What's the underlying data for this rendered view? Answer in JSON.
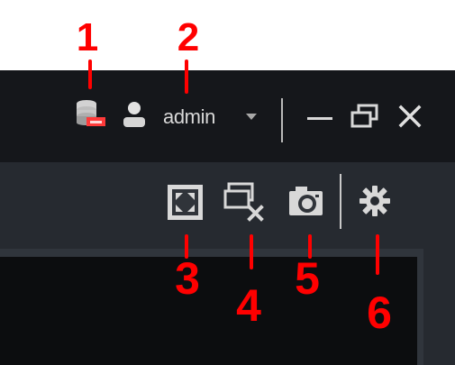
{
  "callouts": {
    "c1": "1",
    "c2": "2",
    "c3": "3",
    "c4": "4",
    "c5": "5",
    "c6": "6"
  },
  "titlebar": {
    "user_name": "admin"
  },
  "icons": {
    "storage_status": "storage-status-icon",
    "user": "user-icon",
    "dropdown": "chevron-down-icon",
    "minimize": "minimize-icon",
    "restore": "restore-icon",
    "close": "close-icon",
    "fullscreen": "fullscreen-icon",
    "close_all_windows": "close-all-windows-icon",
    "snapshot": "camera-icon",
    "settings": "gear-icon"
  },
  "colors": {
    "callout": "#ff0000",
    "titlebar_bg": "#15171b",
    "toolbar_bg": "#262a30",
    "canvas_bg": "#0c0d0f",
    "icon_gray": "#cfcfcf",
    "alert_red": "#ff2f2f"
  }
}
